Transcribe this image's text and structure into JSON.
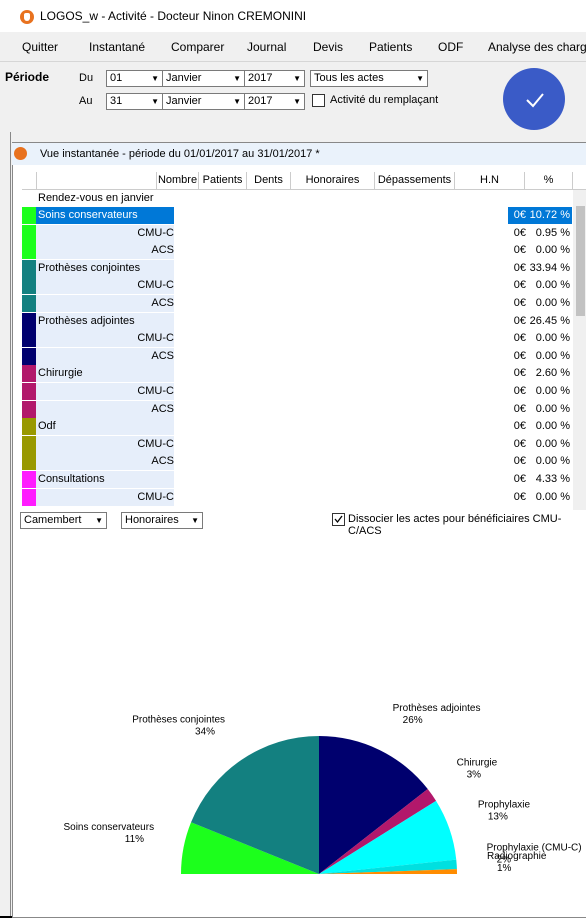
{
  "window": {
    "title": "LOGOS_w - Activité  - Docteur Ninon CREMONINI"
  },
  "menu": [
    "Quitter",
    "Instantané",
    "Comparer",
    "Journal",
    "Devis",
    "Patients",
    "ODF",
    "Analyse des charges"
  ],
  "periode": {
    "label": "Période",
    "du_label": "Du",
    "au_label": "Au",
    "du": {
      "day": "01",
      "month": "Janvier",
      "year": "2017"
    },
    "au": {
      "day": "31",
      "month": "Janvier",
      "year": "2017"
    },
    "actes": "Tous les actes",
    "remplacant_label": "Activité du remplaçant",
    "remplacant_checked": false
  },
  "panel": {
    "title": "Vue instantanée - période du 01/01/2017 au 31/01/2017 *",
    "columns": [
      "Nombre",
      "Patients",
      "Dents",
      "Honoraires",
      "Dépassements",
      "H.N",
      "%"
    ],
    "first_row": "Rendez-vous en janvier",
    "rows": [
      {
        "label": "Soins conservateurs",
        "hn": "0€",
        "pct": "10.72 %",
        "color": "#1cff1c",
        "selected": true
      },
      {
        "label": "CMU-C",
        "hn": "0€",
        "pct": "0.95 %",
        "color": "#1cff1c"
      },
      {
        "label": "ACS",
        "hn": "0€",
        "pct": "0.00 %",
        "color": "#1cff1c"
      },
      {
        "label": "Prothèses conjointes",
        "hn": "0€",
        "pct": "33.94 %",
        "color": "#138080"
      },
      {
        "label": "CMU-C",
        "hn": "0€",
        "pct": "0.00 %",
        "color": "#138080"
      },
      {
        "label": "ACS",
        "hn": "0€",
        "pct": "0.00 %",
        "color": "#138080"
      },
      {
        "label": "Prothèses adjointes",
        "hn": "0€",
        "pct": "26.45 %",
        "color": "#00006e"
      },
      {
        "label": "CMU-C",
        "hn": "0€",
        "pct": "0.00 %",
        "color": "#00006e"
      },
      {
        "label": "ACS",
        "hn": "0€",
        "pct": "0.00 %",
        "color": "#00006e"
      },
      {
        "label": "Chirurgie",
        "hn": "0€",
        "pct": "2.60 %",
        "color": "#b2186b"
      },
      {
        "label": "CMU-C",
        "hn": "0€",
        "pct": "0.00 %",
        "color": "#b2186b"
      },
      {
        "label": "ACS",
        "hn": "0€",
        "pct": "0.00 %",
        "color": "#b2186b"
      },
      {
        "label": "Odf",
        "hn": "0€",
        "pct": "0.00 %",
        "color": "#999900"
      },
      {
        "label": "CMU-C",
        "hn": "0€",
        "pct": "0.00 %",
        "color": "#999900"
      },
      {
        "label": "ACS",
        "hn": "0€",
        "pct": "0.00 %",
        "color": "#999900"
      },
      {
        "label": "Consultations",
        "hn": "0€",
        "pct": "4.33 %",
        "color": "#ff1cff"
      },
      {
        "label": "CMU-C",
        "hn": "0€",
        "pct": "0.00 %",
        "color": "#ff1cff"
      }
    ],
    "chart_type_select": "Camembert",
    "chart_value_select": "Honoraires",
    "dissocier_label": "Dissocier les actes pour bénéficiaires CMU-C/ACS",
    "dissocier_checked": true
  },
  "chart_data": {
    "type": "pie",
    "title": "",
    "half_pie": true,
    "slices": [
      {
        "name": "Soins conservateurs",
        "value": 11,
        "label": "11%",
        "color": "#1cff1c"
      },
      {
        "name": "Prothèses conjointes",
        "value": 34,
        "label": "34%",
        "color": "#138080"
      },
      {
        "name": "Prothèses adjointes",
        "value": 26,
        "label": "26%",
        "color": "#00006e"
      },
      {
        "name": "Chirurgie",
        "value": 3,
        "label": "3%",
        "color": "#b2186b"
      },
      {
        "name": "Prophylaxie",
        "value": 13,
        "label": "13%",
        "color": "#00ffff"
      },
      {
        "name": "Prophylaxie (CMU-C)",
        "value": 2,
        "label": "2%",
        "color": "#00e0e0"
      },
      {
        "name": "Radiographie",
        "value": 1,
        "label": "1%",
        "color": "#ff8c00"
      }
    ],
    "extra_marks": [
      {
        "color": "#ff1cff"
      },
      {
        "color": "#ff8c00"
      },
      {
        "color": "#ff80c0"
      }
    ]
  },
  "colors": {
    "accent": "#3a5bc7",
    "selection": "#0078d7",
    "logo": "#e8721f"
  }
}
